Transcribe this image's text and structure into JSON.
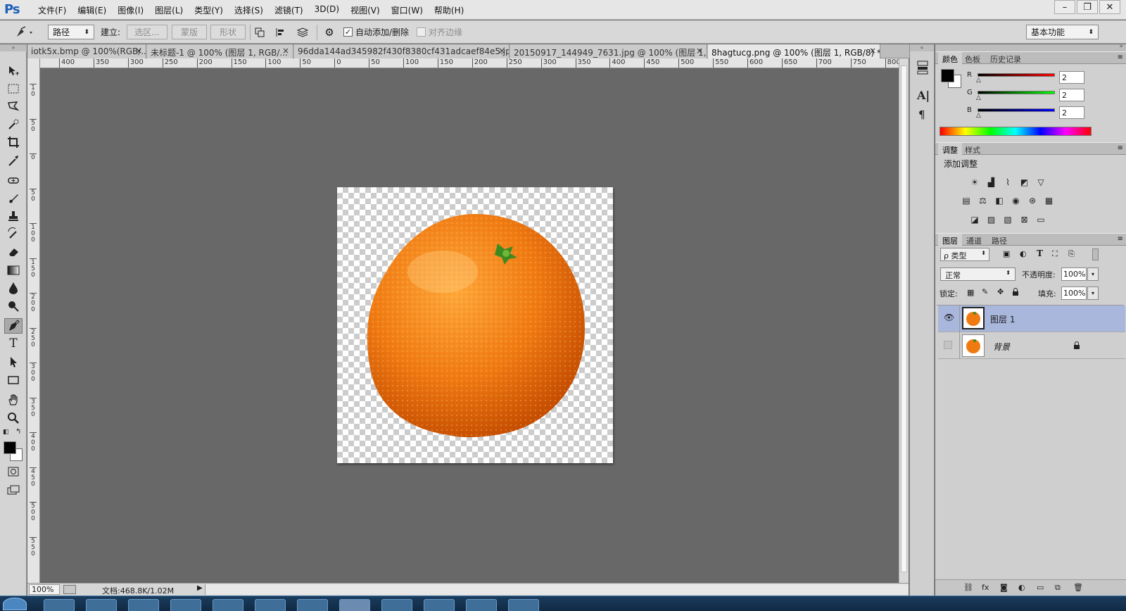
{
  "app": {
    "logo": "Ps",
    "workspace": "基本功能"
  },
  "menu": [
    "文件(F)",
    "编辑(E)",
    "图像(I)",
    "图层(L)",
    "类型(Y)",
    "选择(S)",
    "滤镜(T)",
    "3D(D)",
    "视图(V)",
    "窗口(W)",
    "帮助(H)"
  ],
  "window_controls": {
    "minimize": "–",
    "restore": "❐",
    "close": "✕"
  },
  "options": {
    "mode_value": "路径",
    "make_label": "建立:",
    "selection_btn": "选区...",
    "mask_btn": "蒙版",
    "shape_btn": "形状",
    "auto_add_delete": "自动添加/删除",
    "align_edges": "对齐边缘"
  },
  "doc_tabs": [
    "iotk5x.bmp @ 100%(RGB/...",
    "未标题-1 @ 100% (图层 1, RGB/...",
    "96dda144ad345982f430f8380cf431adcaef84e5.jpg",
    "20150917_144949_7631.jpg @ 100% (图层 1,...",
    "8hagtucg.png @ 100% (图层 1, RGB/8) *"
  ],
  "ruler_h": [
    "400",
    "350",
    "300",
    "250",
    "200",
    "150",
    "100",
    "50",
    "0",
    "50",
    "100",
    "150",
    "200",
    "250",
    "300",
    "350",
    "400",
    "450",
    "500",
    "550",
    "600",
    "650",
    "700",
    "750",
    "800"
  ],
  "ruler_v": [
    "1 0",
    "5 0",
    "0",
    "5 0",
    "1 0 0",
    "1 5 0",
    "2 0 0",
    "2 5 0",
    "3 0 0",
    "3 5 0",
    "4 0 0",
    "4 5 0",
    "5 0 0",
    "5 5 0"
  ],
  "status": {
    "zoom": "100%",
    "doc_info": "文档:468.8K/1.02M"
  },
  "color_panel": {
    "tabs": [
      "颜色",
      "色板",
      "历史记录"
    ],
    "channels": [
      {
        "label": "R",
        "value": "2",
        "color": "#d00000"
      },
      {
        "label": "G",
        "value": "2",
        "color": "#00b000"
      },
      {
        "label": "B",
        "value": "2",
        "color": "#0000d0"
      }
    ],
    "foreground": "#020202",
    "background": "#ffffff"
  },
  "adjust_panel": {
    "tabs": [
      "调整",
      "样式"
    ],
    "title": "添加调整",
    "row1": [
      "brightness-icon",
      "levels-icon",
      "curves-icon",
      "exposure-icon",
      "gradient-triangle-icon"
    ],
    "row2": [
      "vibrance-icon",
      "color-balance-icon",
      "black-white-icon",
      "photo-filter-icon",
      "channel-mixer-icon",
      "color-lookup-icon"
    ],
    "row3": [
      "invert-icon",
      "posterize-icon",
      "threshold-icon",
      "selective-color-icon",
      "gradient-map-icon"
    ]
  },
  "layers_panel": {
    "tabs": [
      "图层",
      "通道",
      "路径"
    ],
    "filter_kind": "ρ 类型",
    "blend_mode": "正常",
    "opacity_label": "不透明度:",
    "opacity": "100%",
    "lock_label": "锁定:",
    "fill_label": "填充:",
    "fill": "100%",
    "layers": [
      {
        "name": "图层 1",
        "visible": true,
        "selected": true,
        "locked": false
      },
      {
        "name": "背景",
        "visible": false,
        "selected": false,
        "locked": true
      }
    ],
    "footer_icons": [
      "link-icon",
      "fx-icon",
      "mask-icon",
      "adjustment-icon",
      "group-icon",
      "new-layer-icon",
      "trash-icon"
    ]
  },
  "colors": {
    "menubar": "#e6e6e6",
    "canvas_bg": "#686868",
    "selected_layer": "#a9b7dc",
    "orange": "#f07a12"
  }
}
